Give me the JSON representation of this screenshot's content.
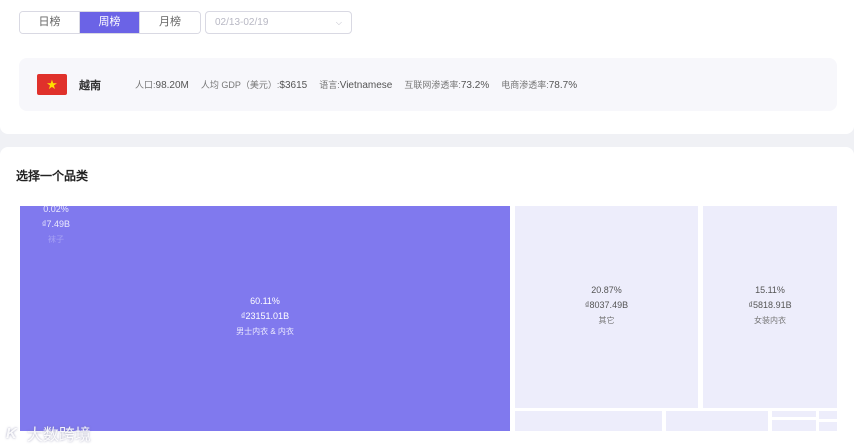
{
  "tabs": [
    {
      "label": "日榜",
      "active": false
    },
    {
      "label": "周榜",
      "active": true
    },
    {
      "label": "月榜",
      "active": false
    }
  ],
  "date_range": {
    "placeholder": "02/13-02/19"
  },
  "country": {
    "flag_icon": "vietnam-flag-icon",
    "flag_colors": {
      "bg": "#e0312b",
      "star": "#ffde00"
    },
    "name": "越南",
    "stats": [
      {
        "label": "人口:",
        "value": "98.20M"
      },
      {
        "label": "人均 GDP（美元）:",
        "value": "$3615"
      },
      {
        "label": "语言:",
        "value": "Vietnamese"
      },
      {
        "label": "互联网渗透率:",
        "value": "73.2%"
      },
      {
        "label": "电商渗透率:",
        "value": "78.7%"
      }
    ]
  },
  "category_section": {
    "title": "选择一个品类"
  },
  "treemap": {
    "accent": "#8079ee",
    "tile_bg": "#ededfb",
    "tiles": [
      {
        "percent": "60.11%",
        "amount": "₫23151.01B",
        "name": "男士内衣 & 内衣"
      },
      {
        "percent": "20.87%",
        "amount": "₫8037.49B",
        "name": "其它"
      },
      {
        "percent": "15.11%",
        "amount": "₫5818.91B",
        "name": "女装内衣"
      },
      {
        "percent": "0.02%",
        "amount": "₫7.49B",
        "name": "袜子"
      }
    ]
  },
  "watermark": {
    "text": "大数跨境",
    "logo": "K"
  }
}
